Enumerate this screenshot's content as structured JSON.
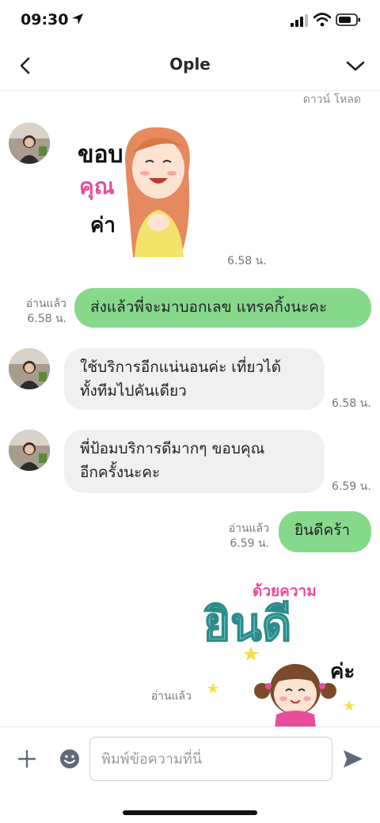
{
  "status": {
    "time": "09:30"
  },
  "header": {
    "title": "Ople"
  },
  "chat": {
    "download_label": "ดาวน์ โหลด",
    "messages": [
      {
        "kind": "sticker",
        "from": "them",
        "sticker_text": [
          "ขอบ",
          "คุณ",
          "ค่า"
        ],
        "time": "6.58 น."
      },
      {
        "kind": "text",
        "from": "me",
        "text": "ส่งแล้วพี่จะมาบอกเลข แทรคกิ้งนะคะ",
        "read": "อ่านแล้ว",
        "time": "6.58 น."
      },
      {
        "kind": "text",
        "from": "them",
        "lines": [
          "ใช้บริการอีกแน่นอนค่ะ เที่ยวได้",
          "ทั้งทีมไปคันเดียว"
        ],
        "time": "6.58 น."
      },
      {
        "kind": "text",
        "from": "them",
        "lines": [
          "พี่ป้อมบริการดีมากๆ ขอบคุณ",
          "อีกครั้งนะคะ"
        ],
        "time": "6.59 น."
      },
      {
        "kind": "text",
        "from": "me",
        "text": "ยินดีคร้า",
        "read": "อ่านแล้ว",
        "time": "6.59 น."
      },
      {
        "kind": "sticker",
        "from": "me",
        "sticker_text": [
          "ด้วยความ",
          "ยินดี",
          "ค่ะ"
        ],
        "read": "อ่านแล้ว"
      }
    ]
  },
  "composer": {
    "placeholder": "พิมพ์ข้อความที่นี่"
  },
  "colors": {
    "outgoing_bubble": "#86d98b",
    "incoming_bubble": "#f0f0f0",
    "sticker_pink": "#e84d9a",
    "sticker_teal": "#5fc9c9"
  }
}
